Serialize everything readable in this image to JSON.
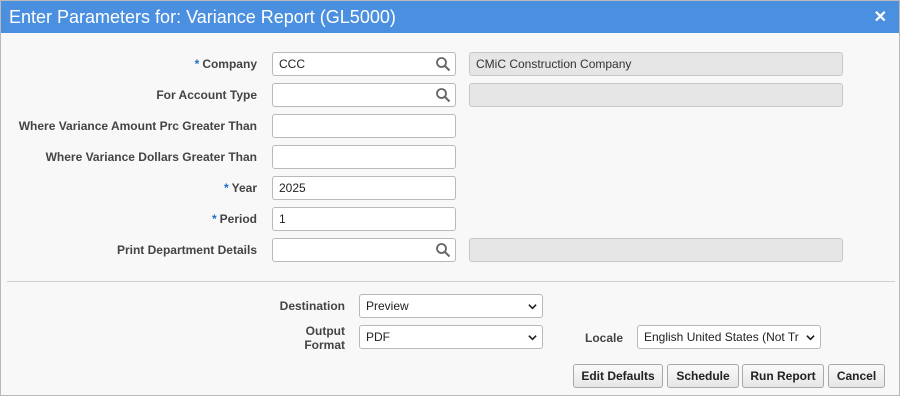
{
  "dialog": {
    "title": "Enter Parameters for: Variance Report (GL5000)",
    "close_glyph": "✕"
  },
  "fields": {
    "company": {
      "label": "Company",
      "required": "*",
      "value": "CCC",
      "description": "CMiC Construction Company"
    },
    "account_type": {
      "label": "For Account Type",
      "value": "",
      "description": ""
    },
    "variance_amount_prc": {
      "label": "Where Variance Amount Prc Greater Than",
      "value": ""
    },
    "variance_dollars": {
      "label": "Where Variance Dollars Greater Than",
      "value": ""
    },
    "year": {
      "label": "Year",
      "required": "*",
      "value": "2025"
    },
    "period": {
      "label": "Period",
      "required": "*",
      "value": "1"
    },
    "print_dept": {
      "label": "Print Department Details",
      "value": "",
      "description": ""
    }
  },
  "output": {
    "destination_label": "Destination",
    "destination_value": "Preview",
    "format_label_line1": "Output",
    "format_label_line2": "Format",
    "format_value": "PDF",
    "locale_label": "Locale",
    "locale_value": "English United States (Not Tr"
  },
  "buttons": {
    "edit_defaults": "Edit Defaults",
    "schedule": "Schedule",
    "run_report": "Run Report",
    "cancel": "Cancel"
  },
  "icons": {
    "lookup": "search-icon",
    "dropdown": "chevron-down-icon",
    "close": "close-icon"
  },
  "colors": {
    "titlebar": "#4a8fe0",
    "required": "#1f6bc6"
  }
}
